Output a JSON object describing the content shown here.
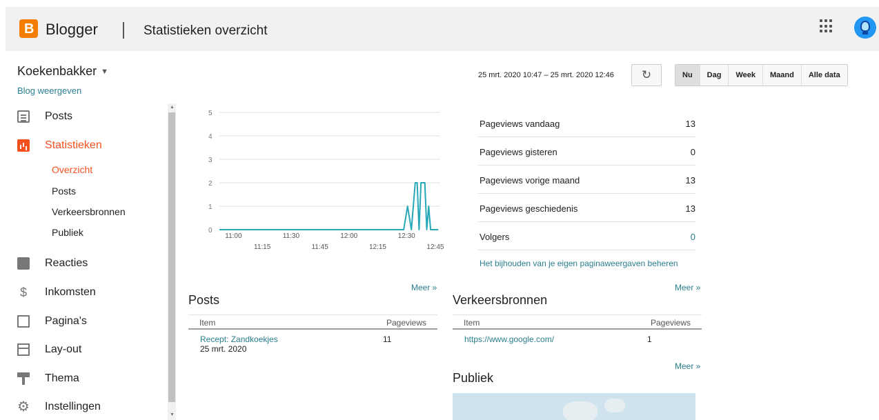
{
  "header": {
    "logo_letter": "B",
    "app_name": "Blogger",
    "page_title": "Statistieken overzicht"
  },
  "sidebar": {
    "blog_name": "Koekenbakker",
    "view_blog": "Blog weergeven",
    "items": [
      {
        "label": "Posts",
        "icon": "posts-icon"
      },
      {
        "label": "Statistieken",
        "icon": "stats-icon",
        "active": true
      },
      {
        "label": "Reacties",
        "icon": "comments-icon"
      },
      {
        "label": "Inkomsten",
        "icon": "dollar-icon"
      },
      {
        "label": "Pagina's",
        "icon": "pages-icon"
      },
      {
        "label": "Lay-out",
        "icon": "layout-icon"
      },
      {
        "label": "Thema",
        "icon": "theme-icon"
      },
      {
        "label": "Instellingen",
        "icon": "gear-icon"
      }
    ],
    "sub_items": [
      {
        "label": "Overzicht",
        "active": true
      },
      {
        "label": "Posts"
      },
      {
        "label": "Verkeersbronnen"
      },
      {
        "label": "Publiek"
      }
    ]
  },
  "controls": {
    "date_range": "25 mrt. 2020 10:47 – 25 mrt. 2020 12:46",
    "refresh_icon": "refresh-icon",
    "ranges": [
      "Nu",
      "Dag",
      "Week",
      "Maand",
      "Alle data"
    ],
    "active_range": "Nu"
  },
  "chart_data": {
    "type": "line",
    "x": [
      "10:47",
      "10:50",
      "11:00",
      "11:10",
      "11:20",
      "11:30",
      "11:40",
      "11:50",
      "12:00",
      "12:10",
      "12:20",
      "12:26",
      "12:28",
      "12:30",
      "12:32",
      "12:34",
      "12:35",
      "12:36",
      "12:37",
      "12:38",
      "12:39",
      "12:40",
      "12:41",
      "12:42",
      "12:43",
      "12:44",
      "12:45",
      "12:46"
    ],
    "y": [
      0,
      0,
      0,
      0,
      0,
      0,
      0,
      0,
      0,
      0,
      0,
      0,
      0,
      1,
      0,
      2,
      2,
      0,
      2,
      2,
      2,
      0,
      1,
      0,
      0,
      0,
      0,
      0
    ],
    "ylim": [
      0,
      5
    ],
    "yticks": [
      0,
      1,
      2,
      3,
      4,
      5
    ],
    "xticks_top": [
      "11:00",
      "11:30",
      "12:00",
      "12:30"
    ],
    "xticks_bottom": [
      "11:15",
      "11:45",
      "12:15",
      "12:45"
    ],
    "grid": true,
    "color": "#26a8b8"
  },
  "stats": [
    {
      "label": "Pageviews vandaag",
      "value": "13"
    },
    {
      "label": "Pageviews gisteren",
      "value": "0"
    },
    {
      "label": "Pageviews vorige maand",
      "value": "13"
    },
    {
      "label": "Pageviews geschiedenis",
      "value": "13"
    },
    {
      "label": "Volgers",
      "value": "0",
      "link": true
    }
  ],
  "manage_link": "Het bijhouden van je eigen paginaweergaven beheren",
  "posts_section": {
    "meer": "Meer »",
    "title": "Posts",
    "col_item": "Item",
    "col_views": "Pageviews",
    "rows": [
      {
        "item": "Recept: Zandkoekjes",
        "date": "25 mrt. 2020",
        "views": "11"
      }
    ]
  },
  "traffic_section": {
    "meer": "Meer »",
    "title": "Verkeersbronnen",
    "col_item": "Item",
    "col_views": "Pageviews",
    "rows": [
      {
        "item": "https://www.google.com/",
        "views": "1"
      }
    ]
  },
  "audience_section": {
    "meer": "Meer »",
    "title": "Publiek"
  },
  "colors": {
    "accent": "#f4511e",
    "link": "#2a7f8f",
    "chart_line": "#26a8b8",
    "logo": "#f57d00"
  }
}
